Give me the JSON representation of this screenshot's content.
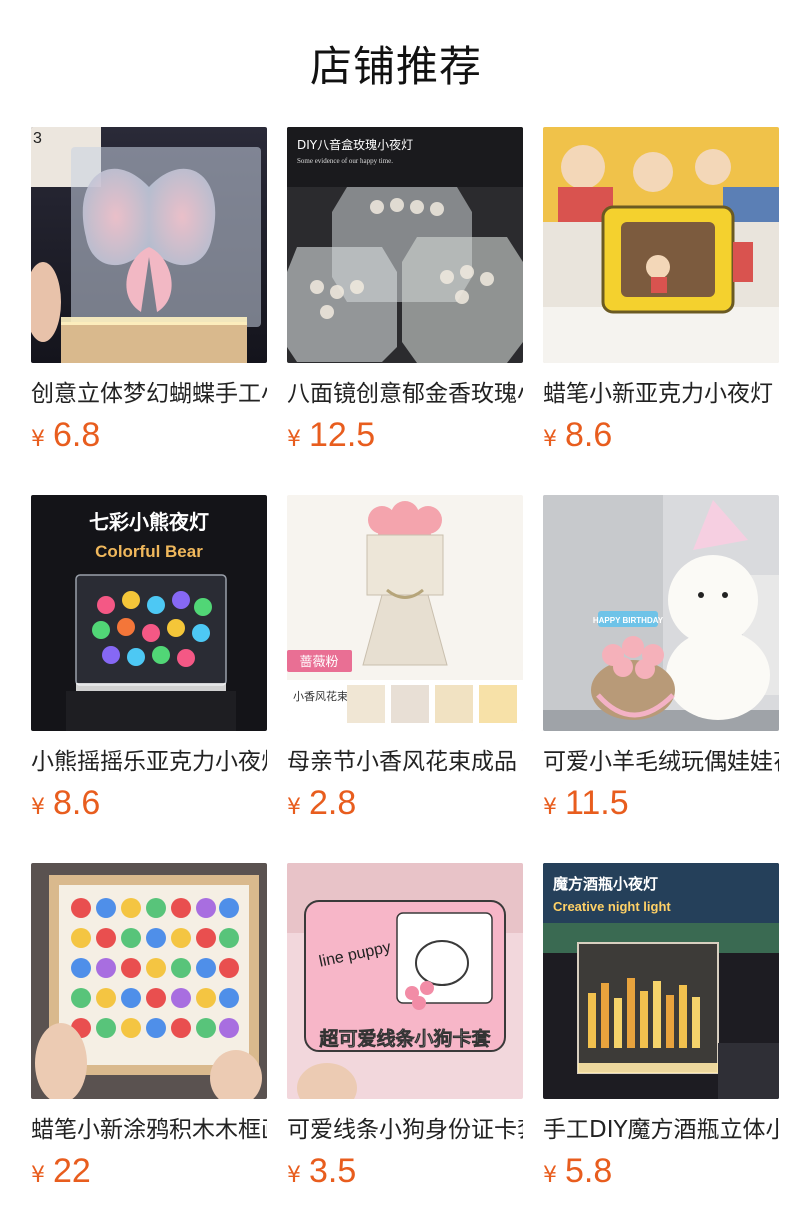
{
  "header": {
    "title": "店铺推荐"
  },
  "currency_symbol": "¥",
  "colors": {
    "price": "#e85d1e"
  },
  "products": [
    {
      "name": "创意立体梦幻蝴蝶手工小夜灯",
      "price": "6.8",
      "image": "acrylic-butterfly-night-light"
    },
    {
      "name": "八面镜创意郁金香玫瑰小夜灯",
      "price": "12.5",
      "image": "octagon-mirror-rose-lamp"
    },
    {
      "name": "蜡笔小新亚克力小夜灯",
      "price": "8.6",
      "image": "crayon-shinchan-tv-lamp"
    },
    {
      "name": "小熊摇摇乐亚克力小夜灯",
      "price": "8.6",
      "image": "colorful-bear-acrylic-lamp"
    },
    {
      "name": "母亲节小香风花束成品",
      "price": "2.8",
      "image": "chanel-style-bouquet"
    },
    {
      "name": "可爱小羊毛绒玩偶娃娃花束",
      "price": "11.5",
      "image": "plush-lamb-flower-basket"
    },
    {
      "name": "蜡笔小新涂鸦积木木框画",
      "price": "22",
      "image": "shinchan-graffiti-frame"
    },
    {
      "name": "可爱线条小狗身份证卡套",
      "price": "3.5",
      "image": "line-puppy-card-holder"
    },
    {
      "name": "手工DIY魔方酒瓶立体小夜灯",
      "price": "5.8",
      "image": "cube-wine-bottle-lamp"
    }
  ],
  "image_texts": {
    "rose_lamp_banner": "DIY八音盒玫瑰小夜灯",
    "rose_lamp_sub": "Some evidence of our happy time.",
    "bear_title": "七彩小熊夜灯",
    "bear_sub": "Colorful Bear",
    "bouquet_tag": "蔷薇粉",
    "bouquet_caption": "小香风花束",
    "puppy_line": "line puppy",
    "puppy_banner": "超可爱线条小狗卡套",
    "cube_title": "魔方酒瓶小夜灯",
    "cube_sub": "Creative night light",
    "birthday": "HAPPY BIRTHDAY"
  }
}
